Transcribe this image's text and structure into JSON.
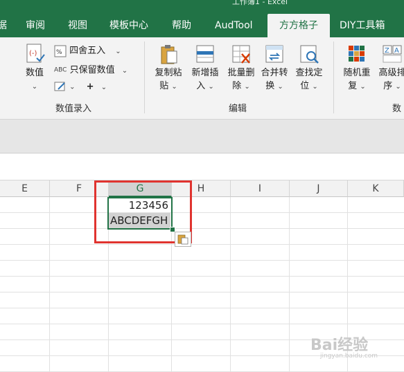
{
  "window": {
    "title": "工作簿1 - Excel"
  },
  "tabs": [
    {
      "label": "据"
    },
    {
      "label": "审阅"
    },
    {
      "label": "视图"
    },
    {
      "label": "模板中心"
    },
    {
      "label": "帮助"
    },
    {
      "label": "AudTool"
    },
    {
      "label": "方方格子",
      "active": true
    },
    {
      "label": "DIY工具箱"
    }
  ],
  "ribbon": {
    "groups": {
      "numeric_entry": {
        "label": "数值录入",
        "numeric_button": {
          "label": "数值"
        },
        "round_button": {
          "label": "四舍五入"
        },
        "keep_value_button": {
          "abc": "ABC",
          "label": "只保留数值"
        },
        "plus_symbol": "+"
      },
      "edit": {
        "label": "编辑",
        "buttons": [
          {
            "line1": "复制粘",
            "line2": "贴"
          },
          {
            "line1": "新增插",
            "line2": "入"
          },
          {
            "line1": "批量删",
            "line2": "除"
          },
          {
            "line1": "合并转",
            "line2": "换"
          },
          {
            "line1": "查找定",
            "line2": "位"
          }
        ]
      },
      "sort": {
        "label": "数",
        "buttons": [
          {
            "line1": "随机重",
            "line2": "复"
          },
          {
            "line1": "高级排",
            "line2": "序"
          }
        ]
      }
    }
  },
  "sheet": {
    "columns": [
      "E",
      "F",
      "G",
      "H",
      "I",
      "J",
      "K"
    ],
    "selected_column": "G",
    "cells": {
      "G1": "123456",
      "G2": "ABCDEFGH"
    }
  },
  "watermark": {
    "logo": "Bai经验",
    "url": "jingyan.baidu.com"
  },
  "colors": {
    "accent": "#217346",
    "highlight_box": "#e0332f"
  }
}
